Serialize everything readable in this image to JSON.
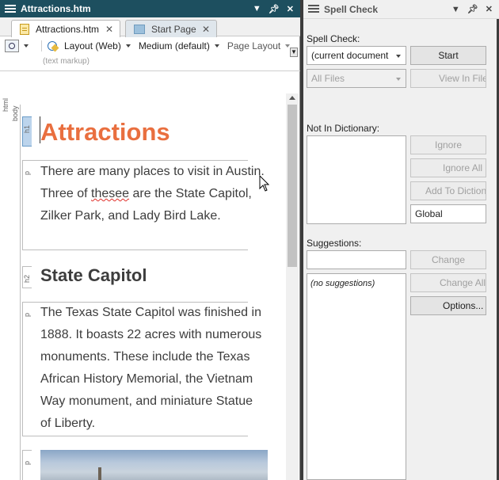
{
  "document_window": {
    "title": "Attractions.htm",
    "tabs": [
      {
        "label": "Attractions.htm",
        "active": true
      },
      {
        "label": "Start Page",
        "active": false
      }
    ],
    "toolbar": {
      "layout": "Layout (Web)",
      "size": "Medium (default)",
      "page_layout": "Page Layout"
    },
    "text_markup_label": "(text markup)",
    "tag_labels": {
      "html": "html",
      "body": "body",
      "h1": "h1",
      "p": "p",
      "h2": "h2"
    },
    "content": {
      "h1": "Attractions",
      "p1_before": "There are many places to visit in Austin. Three of ",
      "p1_misspelled": "thesee",
      "p1_after": " are the State Capitol, Zilker Park, and Lady Bird Lake.",
      "h2": "State Capitol",
      "p2": "The Texas State Capitol was finished in 1888. It boasts 22 acres with numerous monuments. These include the Texas African History Memorial, the Vietnam Way monument, and miniature Statue of Liberty."
    }
  },
  "spell_check": {
    "title": "Spell Check",
    "spell_check_label": "Spell Check:",
    "scope_select": "(current document",
    "files_select": "All Files",
    "start_button": "Start",
    "view_in_file_button": "View In File",
    "not_in_dictionary_label": "Not In Dictionary:",
    "ignore_button": "Ignore",
    "ignore_all_button": "Ignore All",
    "add_to_dictionary_button": "Add To Dictionary",
    "dictionary_select": "Global",
    "suggestions_label": "Suggestions:",
    "change_button": "Change",
    "change_all_button": "Change All",
    "options_button": "Options...",
    "no_suggestions": "(no suggestions)"
  },
  "colors": {
    "doc_titlebar": "#1d4f5f",
    "h1": "#e96f3f",
    "h1_tag_highlight": "#bcd4ec",
    "misspelling_underline": "#e0302a"
  }
}
